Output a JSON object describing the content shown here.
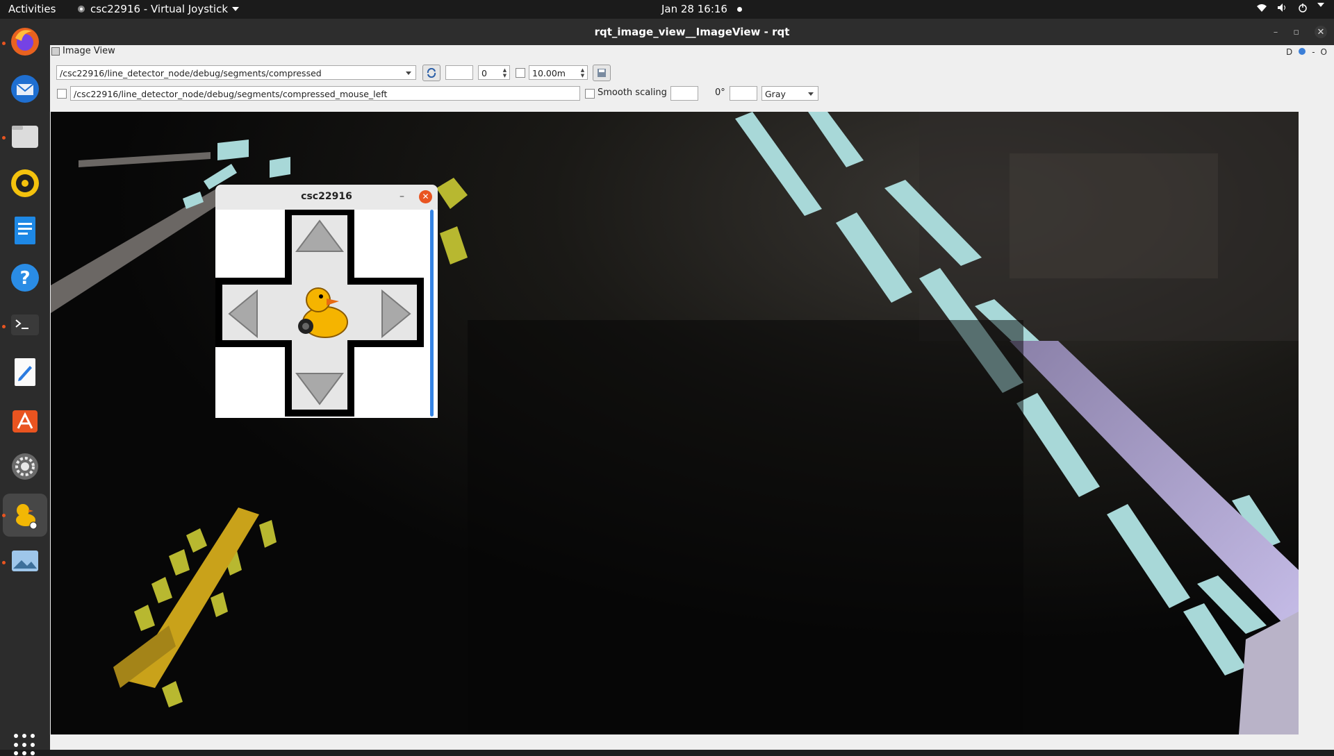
{
  "topbar": {
    "activities": "Activities",
    "app": "csc22916 - Virtual Joystick",
    "clock": "Jan 28  16:16"
  },
  "dock": {
    "items": [
      "firefox-icon",
      "thunderbird-icon",
      "files-icon",
      "rhythmbox-icon",
      "writer-icon",
      "help-icon",
      "terminal-icon",
      "text-editor-icon",
      "app-center-icon",
      "settings-icon",
      "duckie-joystick-icon",
      "image-viewer-icon"
    ],
    "show_apps_icon": "grid-icon"
  },
  "window": {
    "title": "rqt_image_view__ImageView - rqt",
    "panel_title": "Image View",
    "panel_right": "D",
    "panel_right2": "O"
  },
  "toolbar": {
    "topic": "/csc22916/line_detector_node/debug/segments/compressed",
    "spin_value": "0",
    "timeout": "10.00m",
    "mouse_topic": "/csc22916/line_detector_node/debug/segments/compressed_mouse_left",
    "smooth_scaling": "Smooth scaling",
    "rotation": "0°",
    "color_scheme": "Gray"
  },
  "joystick": {
    "title": "csc22916",
    "minimize": "–",
    "close": "✕"
  },
  "colors": {
    "ubuntu_orange": "#e95420",
    "line_cyan": "#a8d8d8",
    "line_yellow": "#d8c030",
    "line_purple": "#b8a8e0"
  }
}
